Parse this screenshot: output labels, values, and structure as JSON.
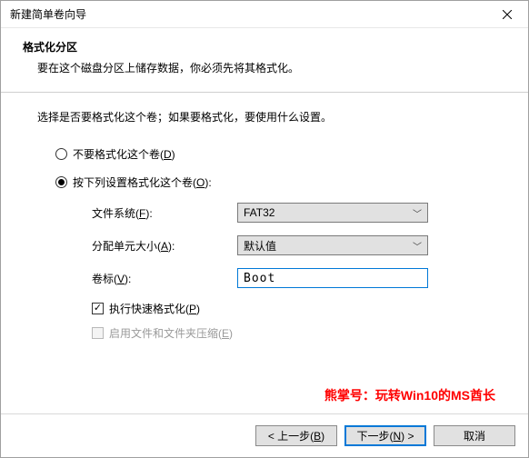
{
  "window": {
    "title": "新建简单卷向导"
  },
  "header": {
    "title": "格式化分区",
    "subtitle": "要在这个磁盘分区上储存数据，你必须先将其格式化。"
  },
  "content": {
    "instruction": "选择是否要格式化这个卷；如果要格式化，要使用什么设置。",
    "option_noformat_pre": "不要格式化这个卷(",
    "option_noformat_hot": "D",
    "option_noformat_post": ")",
    "option_format_pre": "按下列设置格式化这个卷(",
    "option_format_hot": "O",
    "option_format_post": "):",
    "fields": {
      "fs_label_pre": "文件系统(",
      "fs_label_hot": "F",
      "fs_label_post": "):",
      "fs_value": "FAT32",
      "alloc_label_pre": "分配单元大小(",
      "alloc_label_hot": "A",
      "alloc_label_post": "):",
      "alloc_value": "默认值",
      "vol_label_pre": "卷标(",
      "vol_label_hot": "V",
      "vol_label_post": "):",
      "vol_value": "Boot"
    },
    "quick_pre": "执行快速格式化(",
    "quick_hot": "P",
    "quick_post": ")",
    "compress_pre": "启用文件和文件夹压缩(",
    "compress_hot": "E",
    "compress_post": ")"
  },
  "watermark": "熊掌号：玩转Win10的MS酋长",
  "footer": {
    "back_pre": "< 上一步(",
    "back_hot": "B",
    "back_post": ")",
    "next_pre": "下一步(",
    "next_hot": "N",
    "next_post": ") >",
    "cancel": "取消"
  }
}
